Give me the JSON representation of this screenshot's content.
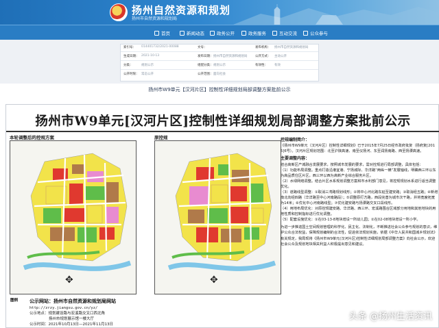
{
  "website": {
    "title": "扬州自然资源和规划",
    "subtitle": "扬州市自然资源和规划局",
    "nav": [
      {
        "label": "首页",
        "icon": "home-icon"
      },
      {
        "label": "新闻动态",
        "icon": "news-icon"
      },
      {
        "label": "政务公开",
        "icon": "public-affairs-icon"
      },
      {
        "label": "政务服务",
        "icon": "service-icon"
      },
      {
        "label": "互动交流",
        "icon": "interaction-icon"
      },
      {
        "label": "公众参与",
        "icon": "participation-icon"
      }
    ],
    "info_rows": [
      {
        "l1": "索引号：",
        "v1": "014401732/2021-00088",
        "l2": "文号：",
        "v2": "",
        "l3": "发布机构：",
        "v3": "扬州市自然资源和规划局"
      },
      {
        "l1": "生成日期：",
        "v1": "2021-10-13",
        "l2": "发布日期：",
        "v2": "扬州市自然资源和规划局",
        "l3": "公开方式：",
        "v3": "主动公开"
      },
      {
        "l1": "分类：",
        "v1": "规划公示",
        "l2": "组配分类：",
        "v2": "规划公示",
        "l3": "有效性：",
        "v3": "有效"
      },
      {
        "l1": "公开时限：",
        "v1": "常态公开",
        "l2": "公开范围：",
        "v2": "面向社会",
        "l3": "",
        "v3": ""
      }
    ]
  },
  "caption": "扬州市W9单元【汉河片区】控制性详细规划局部调整方案批前公示",
  "poster": {
    "title": "扬州市W9单元[汉河片区]控制性详细规划局部调整方案批前公示",
    "left_label": "本轮调整后的控规方案",
    "right_label": "原控规",
    "legend_label": "图例",
    "notice": [
      {
        "type": "h",
        "text": "控规编制简介："
      },
      {
        "type": "p",
        "text": "《扬州市W9单元（汉河片区）控制性详细规划》已于2015年7月25日经市政府批复（扬府复[2015]6号）。汉河片区规划范围：北至沪陕高速、南至仪扬河、东至润扬南路、西至扬溧高速。"
      },
      {
        "type": "h",
        "text": "主要调整内容："
      },
      {
        "type": "p",
        "text": "结合高新区产城融合发展要求，按照城市发展的要求，需对控规进行局部调整，具体包括："
      },
      {
        "type": "p",
        "text": "（1）功能布局调整。重点打造沿港宜港、宁扬城际、华洋路“两纵一横”发展轴线，明确西三环以东为高品质住区片区，西三环以西为高新产业综合服务片区。"
      },
      {
        "type": "p",
        "text": "（2）水绿网络调整。结合片区水系规划调整方案和市水利部门意见，将控规规划水系进行适当调整优化。"
      },
      {
        "type": "p",
        "text": "（3）道路线型调整：①取消三湾路规划线形；②将中心河北路东延至建安路；③取消经五路；④新增南北向经四路（华洋路至中心河南路段）；⑤调整原打方路，西段完善为城市次干路，并将宽度拓宽为14米；⑥优化中心河南路线型；⑦优化建安路与扬溧路交叉口段线形。"
      },
      {
        "type": "p",
        "text": "（4）用地布局优化：对原控规建安路、华洋路、西三环、宏溪路围合区域部分用地和其他地块的用地性质和控制指标进行优化调整。"
      },
      {
        "type": "p",
        "text": "（5）配套设施优化：①在03-13-8地块增设一所幼儿园；②在02-08地块增设一所小学。"
      },
      {
        "type": "p",
        "text": "为进一步推进国土空间规划管理的科学化、民主化、法制化，不断推进社会公众参与规划的意识，维护公众合法权益，保障规划编制的合法性，促进依法规划实施，依据《中华人民共和国城乡规划法》有关规定，我局现将《扬州市W9单元(汉河片区)控制性详细规划局部调整方案》向社会公示，欢迎社会公众及规划地块相关利益人积极提出意见和建议。"
      }
    ],
    "footer": {
      "head": "公示网站：扬州市自然资源和规划局网站",
      "url": "http://zrzy.jiangsu.gov.cn/yz/",
      "place_label": "公示地点：",
      "place1": "规划建设路与宏溪路交叉口西北角",
      "place2": "扬州市规划展示馆一楼大厅",
      "time": "公示时间：2021年10月13日—2021年11月13日"
    }
  },
  "watermark": "头条 @扬州生活资讯",
  "colors": {
    "header_blue": "#2a7dc4",
    "residential_yellow": "#f2e34a",
    "commercial_red": "#e0392f",
    "industrial_brown": "#b07a4a",
    "green_space": "#5fbd4a",
    "water_blue": "#7fc6e8",
    "education_pink": "#e88bd0"
  }
}
